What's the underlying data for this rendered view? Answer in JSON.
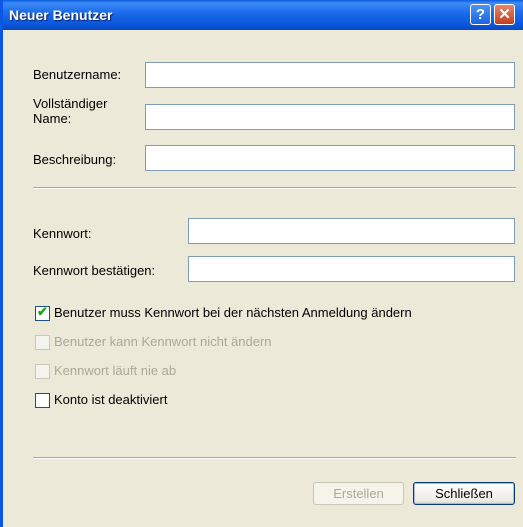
{
  "window": {
    "title": "Neuer Benutzer",
    "help_glyph": "?",
    "close_glyph": "✕"
  },
  "account": {
    "username_label": "Benutzername:",
    "fullname_label_line1": "Vollständiger",
    "fullname_label_line2": "Name:",
    "description_label": "Beschreibung:",
    "username_value": "",
    "fullname_value": "",
    "description_value": ""
  },
  "password": {
    "password_label": "Kennwort:",
    "confirm_label": "Kennwort bestätigen:",
    "password_value": "",
    "confirm_value": ""
  },
  "options": [
    {
      "label": "Benutzer muss Kennwort bei der nächsten Anmeldung ändern",
      "checked": true,
      "enabled": true
    },
    {
      "label": "Benutzer kann Kennwort nicht ändern",
      "checked": false,
      "enabled": false
    },
    {
      "label": "Kennwort läuft nie ab",
      "checked": false,
      "enabled": false
    },
    {
      "label": "Konto ist deaktiviert",
      "checked": false,
      "enabled": true
    }
  ],
  "buttons": {
    "create_label": "Erstellen",
    "close_label": "Schließen"
  },
  "icons": {
    "help": "help-icon",
    "close": "close-icon",
    "check": "checkmark-icon"
  },
  "colors": {
    "titlebar": "#0A5BE0",
    "dialog_bg": "#ECE9D8",
    "check_green": "#21A121",
    "disabled_text": "#ACA899"
  }
}
